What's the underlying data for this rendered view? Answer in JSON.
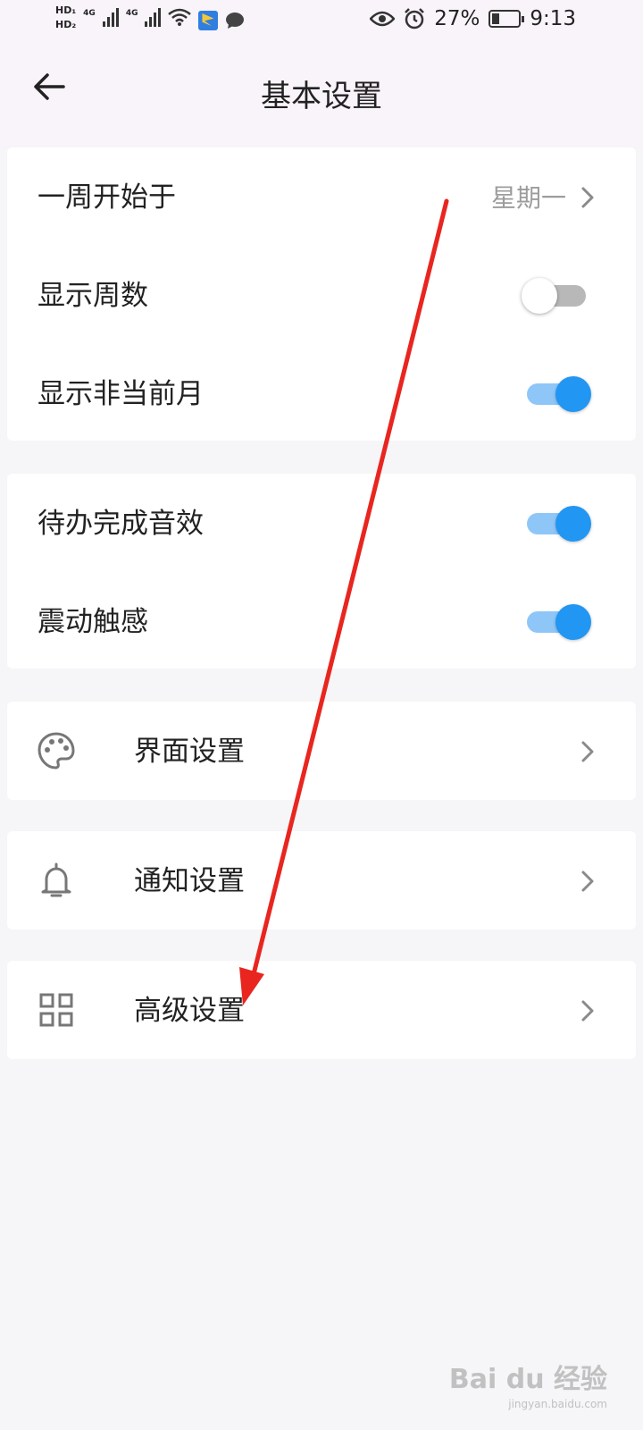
{
  "status_bar": {
    "hd1": "HD₁",
    "hd2": "HD₂",
    "net1": "4G",
    "net2": "4G",
    "battery_pct": "27%",
    "time": "9:13"
  },
  "header": {
    "title": "基本设置",
    "back_icon": "arrow-left-icon"
  },
  "general_settings": [
    {
      "label": "一周开始于",
      "value": "星期一",
      "type": "select"
    },
    {
      "label": "显示周数",
      "type": "toggle",
      "on": false
    },
    {
      "label": "显示非当前月",
      "type": "toggle",
      "on": true
    }
  ],
  "sound_settings": [
    {
      "label": "待办完成音效",
      "type": "toggle",
      "on": true
    },
    {
      "label": "震动触感",
      "type": "toggle",
      "on": true
    }
  ],
  "nav_items": [
    {
      "label": "界面设置",
      "icon": "palette-icon"
    },
    {
      "label": "通知设置",
      "icon": "bell-icon"
    },
    {
      "label": "高级设置",
      "icon": "grid-icon"
    }
  ],
  "colors": {
    "accent": "#2196f3",
    "accent_track": "#8fc6f8",
    "annotation_arrow": "#e8261f"
  },
  "watermark": {
    "brand": "Bai du 经验",
    "url": "jingyan.baidu.com"
  }
}
